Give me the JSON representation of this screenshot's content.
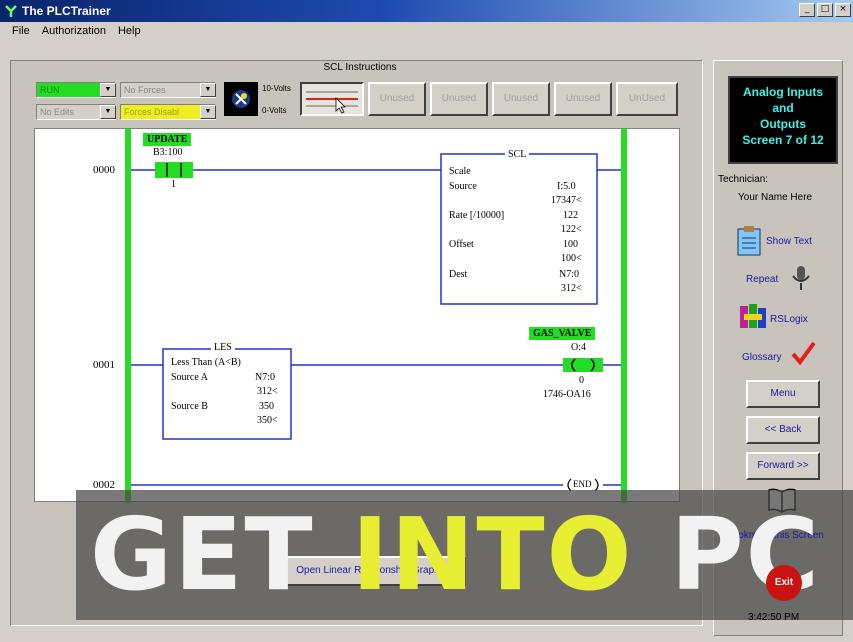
{
  "window": {
    "title": "The PLCTrainer",
    "controls": [
      "_",
      "□",
      "×"
    ]
  },
  "menu": [
    "File",
    "Authorization",
    "Help"
  ],
  "panel": {
    "caption": "SCL Instructions",
    "status": {
      "run": "RUN",
      "forces": "No Forces",
      "edits": "No Edits",
      "forces_disable": "Forces Disabl"
    },
    "volts_top": "10-Volts",
    "volts_bottom": "0-Volts",
    "instr_buttons": [
      "Unused",
      "Unused",
      "Unused",
      "Unused",
      "UnUsed"
    ]
  },
  "ladder": {
    "rungs": [
      {
        "number": "0000",
        "contact": {
          "tag": "UPDATE",
          "address": "B3:100",
          "bit": "1"
        },
        "block": {
          "title": "SCL",
          "lines": [
            {
              "label": "Scale",
              "v1": "",
              "v2": ""
            },
            {
              "label": "Source",
              "v1": "I:5.0",
              "v2": "17347<"
            },
            {
              "label": "Rate [/10000]",
              "v1": "122",
              "v2": "122<"
            },
            {
              "label": "Offset",
              "v1": "100",
              "v2": "100<"
            },
            {
              "label": "Dest",
              "v1": "N7:0",
              "v2": "312<"
            }
          ]
        }
      },
      {
        "number": "0001",
        "block": {
          "title": "LES",
          "lines": [
            {
              "label": "Less Than (A<B)",
              "v1": "",
              "v2": ""
            },
            {
              "label": "Source A",
              "v1": "N7:0",
              "v2": "312<"
            },
            {
              "label": "Source B",
              "v1": "350",
              "v2": "350<"
            }
          ]
        },
        "coil": {
          "tag": "GAS_VALVE",
          "address": "O:4",
          "bit": "0",
          "module": "1746-OA16"
        }
      },
      {
        "number": "0002",
        "end": "END"
      }
    ]
  },
  "right": {
    "screen_lines": [
      "Analog Inputs",
      "and",
      "Outputs",
      "Screen 7 of 12"
    ],
    "technician_label": "Technician:",
    "technician_name": "Your Name Here",
    "show_text": "Show Text",
    "repeat": "Repeat",
    "rslogix": "RSLogix",
    "glossary": "Glossary",
    "menu_btn": "Menu",
    "back_btn": "<< Back",
    "forward_btn": "Forward >>",
    "bookmark": "Bookmark this Screen",
    "exit": "Exit",
    "time": "3:42:50 PM"
  },
  "graph_button": "Open Linear Relationship Graph",
  "watermark": {
    "w1": "GET",
    "w2": "INTO",
    "w3": "PC"
  },
  "colors": {
    "title_bar": "#0a246a",
    "green": "#22dd22",
    "screen_text": "#3ff2e8",
    "banner_yellow": "#e8ee32"
  }
}
